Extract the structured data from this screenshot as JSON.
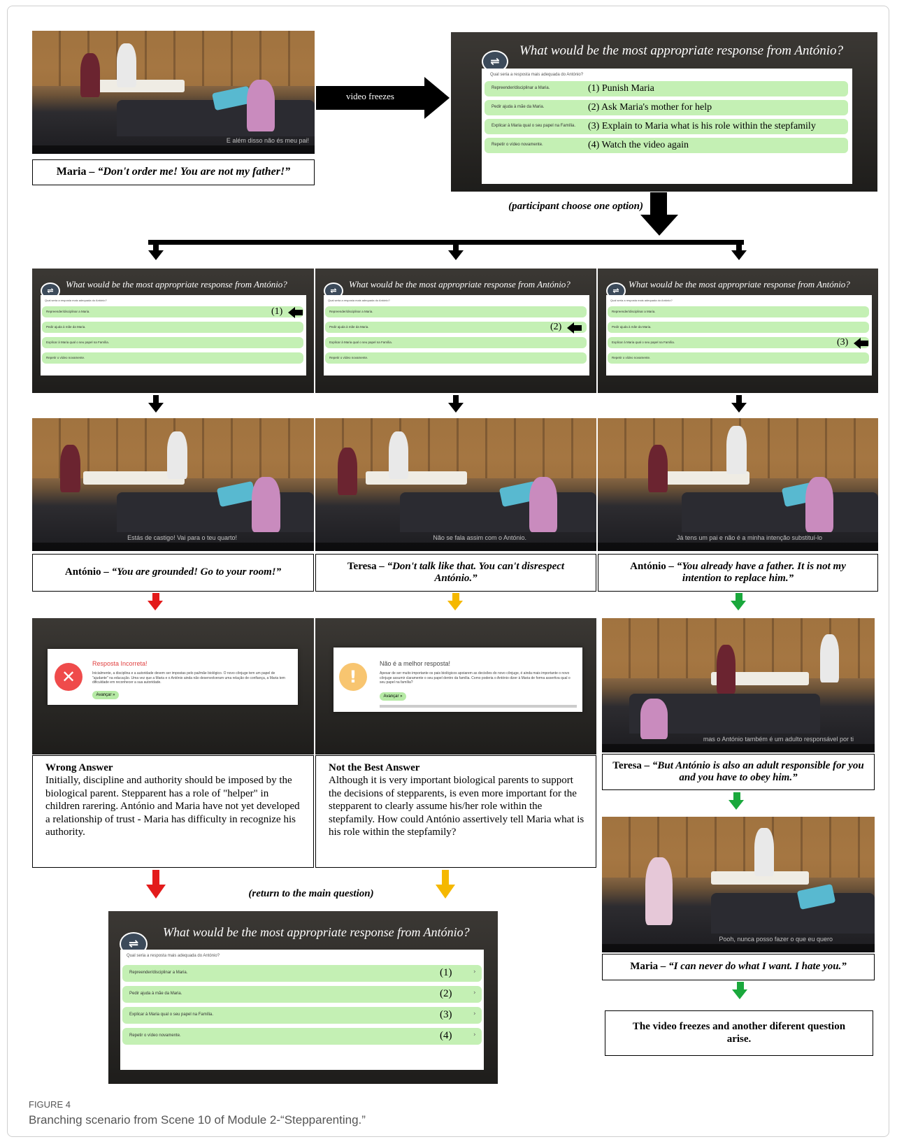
{
  "question_title": "What would be the most appropriate response from António?",
  "question_pt": "Qual seria a resposta mais adequada do António?",
  "options_pt": [
    "Repreender/disciplinar a Maria.",
    "Pedir ajuda à mãe da Maria.",
    "Explicar à Maria qual o seu papel na Família.",
    "Repetir o vídeo novamente."
  ],
  "options_en": [
    "(1) Punish Maria",
    "(2) Ask Maria's mother for help",
    "(3) Explain to Maria what is his role within the stepfamily",
    "(4) Watch the video again"
  ],
  "numbers": [
    "(1)",
    "(2)",
    "(3)",
    "(4)"
  ],
  "chevron": "›",
  "labels": {
    "video_freezes": "video freezes",
    "participant_choose": "(participant choose one option)",
    "return_main": "(return to the main question)"
  },
  "subtitles": {
    "top": "E além disso não és meu pai!",
    "p1": "Estás de castigo! Vai para o teu quarto!",
    "p2": "Não se fala assim com o António.",
    "p3": "Já tens um pai e não é a minha intenção substituí-lo",
    "right1": "mas o António também é um adulto responsável por ti",
    "right2": "Pooh, nunca posso fazer o que eu quero"
  },
  "captions": {
    "maria1_speaker": "Maria",
    "maria1_quote": "– “Don't order me! You are not my father!”",
    "antonio1_speaker": "António",
    "antonio1_quote": "– “You are grounded! Go to your room!”",
    "teresa1_speaker": "Teresa",
    "teresa1_quote": "– “Don't talk like that. You can't disrespect António.”",
    "antonio2_speaker": "António",
    "antonio2_quote": "– “You already have a father. It is not my intention to replace him.”",
    "teresa2_speaker": "Teresa",
    "teresa2_quote": "– “But António is also an adult responsible for you and you have to obey him.”",
    "maria2_speaker": "Maria",
    "maria2_quote": "– “I can never do what I want. I hate you.”",
    "final": "The video freezes and another diferent question arise."
  },
  "feedback": {
    "wrong_title": "Resposta Incorreta!",
    "wrong_text": "Inicialmente, a disciplina e a autoridade devem ser impostas pelo pai/mãe biológico. O novo cônjuge tem um papel de \"ajudante\" na educação. Uma vez que a Maria e o António ainda não desenvolveram uma relação de confiança, a Maria tem dificuldade em reconhecer a sua autoridade.",
    "best_title": "Não é a melhor resposta!",
    "best_text": "Apesar de ser muito importante os pais biológicos apoiarem as decisões do novo cônjuge, é ainda mais importante o novo cônjuge assumir claramente o seu papel dentro da família. Como poderia o António dizer à Maria de forma assertiva qual o seu papel na família?",
    "button": "Avançar »"
  },
  "boxes": {
    "wrong_heading": "Wrong Answer",
    "wrong_body": "Initially, discipline and authority should be imposed by the biological parent. Stepparent has a role of \"helper\" in children rarering. António and Maria have not yet developed a relationship of trust - Maria has difficulty in recognize his authority.",
    "best_heading": "Not the Best Answer",
    "best_body": "Although it is very important biological parents to support the decisions of stepparents, is even more important for the stepparent to clearly assume his/her role within the stepfamily. How could António assertively tell Maria what is his role within the stepfamily?"
  },
  "figure": {
    "label": "FIGURE 4",
    "caption": "Branching scenario from Scene 10 of Module 2-“Stepparenting.”"
  },
  "colors": {
    "option_green": "#c4f0b4",
    "arrow_red": "#e31b1b",
    "arrow_yellow": "#f5b800",
    "arrow_green": "#1aa83c"
  }
}
